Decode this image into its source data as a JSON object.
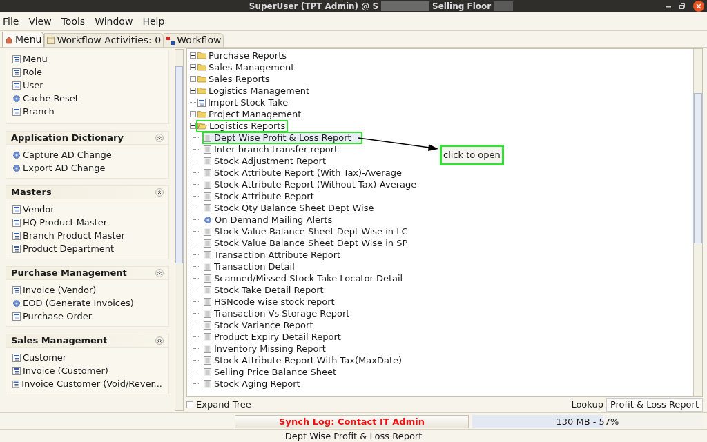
{
  "window": {
    "title_parts": [
      "SuperUser (TPT Admin) @ S",
      "Selling Floor"
    ]
  },
  "menu_bar": [
    {
      "label": "File"
    },
    {
      "label": "View"
    },
    {
      "label": "Tools"
    },
    {
      "label": "Window"
    },
    {
      "label": "Help"
    }
  ],
  "tabs": [
    {
      "label": "Menu",
      "kind": "home",
      "selected": true
    },
    {
      "label": "Workflow Activities: 0",
      "kind": "activities",
      "selected": false
    },
    {
      "label": "Workflow",
      "kind": "workflow",
      "selected": false
    }
  ],
  "sidebar": {
    "groups": [
      {
        "items": [
          {
            "label": "Menu",
            "kind": "window"
          },
          {
            "label": "Role",
            "kind": "window"
          },
          {
            "label": "User",
            "kind": "window"
          },
          {
            "label": "Cache Reset",
            "kind": "process"
          },
          {
            "label": "Branch",
            "kind": "window"
          }
        ]
      },
      {
        "title": "Application Dictionary",
        "items": [
          {
            "label": "Capture AD Change",
            "kind": "process"
          },
          {
            "label": "Export AD Change",
            "kind": "process"
          }
        ]
      },
      {
        "title": "Masters",
        "items": [
          {
            "label": "Vendor",
            "kind": "window"
          },
          {
            "label": "HQ Product Master",
            "kind": "window"
          },
          {
            "label": "Branch Product Master",
            "kind": "window"
          },
          {
            "label": "Product Department",
            "kind": "window"
          }
        ]
      },
      {
        "title": "Purchase Management",
        "items": [
          {
            "label": "Invoice (Vendor)",
            "kind": "window"
          },
          {
            "label": "EOD (Generate Invoices)",
            "kind": "process"
          },
          {
            "label": "Purchase Order",
            "kind": "window"
          }
        ]
      },
      {
        "title": "Sales Management",
        "items": [
          {
            "label": "Customer",
            "kind": "window"
          },
          {
            "label": "Invoice (Customer)",
            "kind": "window"
          },
          {
            "label": "Invoice Customer (Void/Rever...",
            "kind": "window"
          }
        ]
      }
    ]
  },
  "tree": {
    "items": [
      {
        "label": "Purchase Reports",
        "kind": "folder",
        "expanded": false,
        "outlined": false
      },
      {
        "label": "Sales Management",
        "kind": "folder",
        "expanded": false,
        "outlined": false
      },
      {
        "label": "Sales Reports",
        "kind": "folder",
        "expanded": false,
        "outlined": false
      },
      {
        "label": "Logistics Management",
        "kind": "folder",
        "expanded": false,
        "outlined": false
      },
      {
        "label": "Import Stock Take",
        "kind": "window",
        "outlined": false
      },
      {
        "label": "Project Management",
        "kind": "folder",
        "expanded": false,
        "outlined": false
      },
      {
        "label": "Logistics Reports",
        "kind": "folder",
        "expanded": true,
        "outlined": true,
        "children": [
          {
            "label": "Dept Wise Profit & Loss Report",
            "kind": "report",
            "selected": true,
            "outlined": true
          },
          {
            "label": "Inter branch transfer report",
            "kind": "report",
            "selected": false,
            "outlined": false
          },
          {
            "label": "Stock Adjustment Report",
            "kind": "report",
            "selected": false,
            "outlined": false
          },
          {
            "label": "Stock Attribute Report (With Tax)-Average",
            "kind": "report",
            "selected": false,
            "outlined": false
          },
          {
            "label": "Stock Attribute Report (Without Tax)-Average",
            "kind": "report",
            "selected": false,
            "outlined": false
          },
          {
            "label": "Stock Attribute Report",
            "kind": "report",
            "selected": false,
            "outlined": false
          },
          {
            "label": "Stock Qty Balance Sheet Dept Wise",
            "kind": "report",
            "selected": false,
            "outlined": false
          },
          {
            "label": "On Demand Mailing Alerts",
            "kind": "process",
            "selected": false,
            "outlined": false
          },
          {
            "label": "Stock Value Balance Sheet Dept Wise in LC",
            "kind": "report",
            "selected": false,
            "outlined": false
          },
          {
            "label": "Stock Value Balance Sheet Dept Wise in SP",
            "kind": "report",
            "selected": false,
            "outlined": false
          },
          {
            "label": "Transaction Attribute Report",
            "kind": "report",
            "selected": false,
            "outlined": false
          },
          {
            "label": "Transaction Detail",
            "kind": "report",
            "selected": false,
            "outlined": false
          },
          {
            "label": "Scanned/Missed Stock Take Locator Detail",
            "kind": "report",
            "selected": false,
            "outlined": false
          },
          {
            "label": "Stock Take Detail Report",
            "kind": "report",
            "selected": false,
            "outlined": false
          },
          {
            "label": "HSNcode wise stock report",
            "kind": "report",
            "selected": false,
            "outlined": false
          },
          {
            "label": "Transaction Vs Storage Report",
            "kind": "report",
            "selected": false,
            "outlined": false
          },
          {
            "label": "Stock Variance Report",
            "kind": "report",
            "selected": false,
            "outlined": false
          },
          {
            "label": "Product Expiry Detail Report",
            "kind": "report",
            "selected": false,
            "outlined": false
          },
          {
            "label": "Inventory Missing Report",
            "kind": "report",
            "selected": false,
            "outlined": false
          },
          {
            "label": "Stock Attribute Report With Tax(MaxDate)",
            "kind": "report",
            "selected": false,
            "outlined": false
          },
          {
            "label": "Selling Price Balance Sheet",
            "kind": "report",
            "selected": false,
            "outlined": false
          },
          {
            "label": "Stock Aging Report",
            "kind": "report",
            "selected": false,
            "outlined": false
          }
        ]
      }
    ],
    "callout": "click to open",
    "expand_tree": {
      "label": "Expand Tree",
      "checked": false
    },
    "lookup": {
      "label": "Lookup",
      "value": "Profit & Loss Report"
    }
  },
  "status_bar": {
    "message": "Synch Log: Contact IT Admin",
    "memory": {
      "reading": "130 MB - 57%",
      "level": 0.57
    }
  },
  "footer": "Dept Wise Profit & Loss Report"
}
